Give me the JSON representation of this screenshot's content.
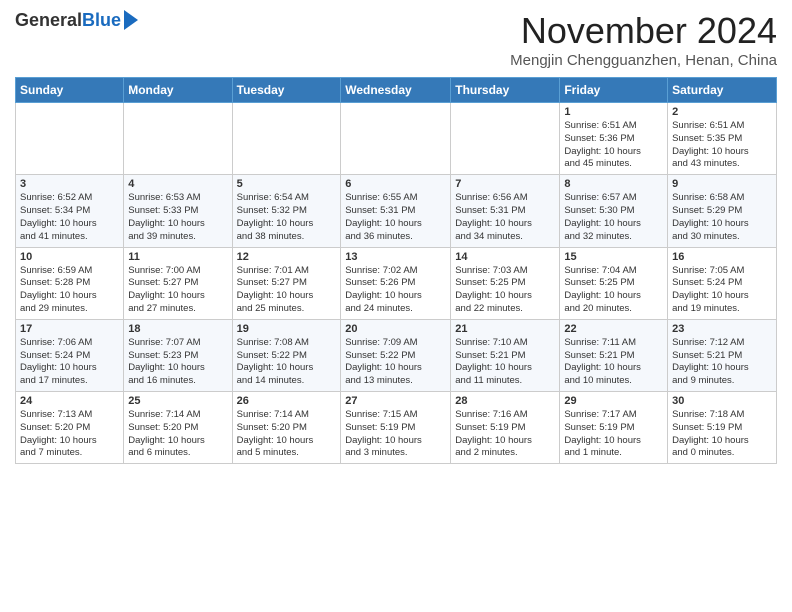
{
  "header": {
    "logo_general": "General",
    "logo_blue": "Blue",
    "month": "November 2024",
    "location": "Mengjin Chengguanzhen, Henan, China"
  },
  "days_of_week": [
    "Sunday",
    "Monday",
    "Tuesday",
    "Wednesday",
    "Thursday",
    "Friday",
    "Saturday"
  ],
  "weeks": [
    [
      {
        "day": "",
        "info": ""
      },
      {
        "day": "",
        "info": ""
      },
      {
        "day": "",
        "info": ""
      },
      {
        "day": "",
        "info": ""
      },
      {
        "day": "",
        "info": ""
      },
      {
        "day": "1",
        "info": "Sunrise: 6:51 AM\nSunset: 5:36 PM\nDaylight: 10 hours\nand 45 minutes."
      },
      {
        "day": "2",
        "info": "Sunrise: 6:51 AM\nSunset: 5:35 PM\nDaylight: 10 hours\nand 43 minutes."
      }
    ],
    [
      {
        "day": "3",
        "info": "Sunrise: 6:52 AM\nSunset: 5:34 PM\nDaylight: 10 hours\nand 41 minutes."
      },
      {
        "day": "4",
        "info": "Sunrise: 6:53 AM\nSunset: 5:33 PM\nDaylight: 10 hours\nand 39 minutes."
      },
      {
        "day": "5",
        "info": "Sunrise: 6:54 AM\nSunset: 5:32 PM\nDaylight: 10 hours\nand 38 minutes."
      },
      {
        "day": "6",
        "info": "Sunrise: 6:55 AM\nSunset: 5:31 PM\nDaylight: 10 hours\nand 36 minutes."
      },
      {
        "day": "7",
        "info": "Sunrise: 6:56 AM\nSunset: 5:31 PM\nDaylight: 10 hours\nand 34 minutes."
      },
      {
        "day": "8",
        "info": "Sunrise: 6:57 AM\nSunset: 5:30 PM\nDaylight: 10 hours\nand 32 minutes."
      },
      {
        "day": "9",
        "info": "Sunrise: 6:58 AM\nSunset: 5:29 PM\nDaylight: 10 hours\nand 30 minutes."
      }
    ],
    [
      {
        "day": "10",
        "info": "Sunrise: 6:59 AM\nSunset: 5:28 PM\nDaylight: 10 hours\nand 29 minutes."
      },
      {
        "day": "11",
        "info": "Sunrise: 7:00 AM\nSunset: 5:27 PM\nDaylight: 10 hours\nand 27 minutes."
      },
      {
        "day": "12",
        "info": "Sunrise: 7:01 AM\nSunset: 5:27 PM\nDaylight: 10 hours\nand 25 minutes."
      },
      {
        "day": "13",
        "info": "Sunrise: 7:02 AM\nSunset: 5:26 PM\nDaylight: 10 hours\nand 24 minutes."
      },
      {
        "day": "14",
        "info": "Sunrise: 7:03 AM\nSunset: 5:25 PM\nDaylight: 10 hours\nand 22 minutes."
      },
      {
        "day": "15",
        "info": "Sunrise: 7:04 AM\nSunset: 5:25 PM\nDaylight: 10 hours\nand 20 minutes."
      },
      {
        "day": "16",
        "info": "Sunrise: 7:05 AM\nSunset: 5:24 PM\nDaylight: 10 hours\nand 19 minutes."
      }
    ],
    [
      {
        "day": "17",
        "info": "Sunrise: 7:06 AM\nSunset: 5:24 PM\nDaylight: 10 hours\nand 17 minutes."
      },
      {
        "day": "18",
        "info": "Sunrise: 7:07 AM\nSunset: 5:23 PM\nDaylight: 10 hours\nand 16 minutes."
      },
      {
        "day": "19",
        "info": "Sunrise: 7:08 AM\nSunset: 5:22 PM\nDaylight: 10 hours\nand 14 minutes."
      },
      {
        "day": "20",
        "info": "Sunrise: 7:09 AM\nSunset: 5:22 PM\nDaylight: 10 hours\nand 13 minutes."
      },
      {
        "day": "21",
        "info": "Sunrise: 7:10 AM\nSunset: 5:21 PM\nDaylight: 10 hours\nand 11 minutes."
      },
      {
        "day": "22",
        "info": "Sunrise: 7:11 AM\nSunset: 5:21 PM\nDaylight: 10 hours\nand 10 minutes."
      },
      {
        "day": "23",
        "info": "Sunrise: 7:12 AM\nSunset: 5:21 PM\nDaylight: 10 hours\nand 9 minutes."
      }
    ],
    [
      {
        "day": "24",
        "info": "Sunrise: 7:13 AM\nSunset: 5:20 PM\nDaylight: 10 hours\nand 7 minutes."
      },
      {
        "day": "25",
        "info": "Sunrise: 7:14 AM\nSunset: 5:20 PM\nDaylight: 10 hours\nand 6 minutes."
      },
      {
        "day": "26",
        "info": "Sunrise: 7:14 AM\nSunset: 5:20 PM\nDaylight: 10 hours\nand 5 minutes."
      },
      {
        "day": "27",
        "info": "Sunrise: 7:15 AM\nSunset: 5:19 PM\nDaylight: 10 hours\nand 3 minutes."
      },
      {
        "day": "28",
        "info": "Sunrise: 7:16 AM\nSunset: 5:19 PM\nDaylight: 10 hours\nand 2 minutes."
      },
      {
        "day": "29",
        "info": "Sunrise: 7:17 AM\nSunset: 5:19 PM\nDaylight: 10 hours\nand 1 minute."
      },
      {
        "day": "30",
        "info": "Sunrise: 7:18 AM\nSunset: 5:19 PM\nDaylight: 10 hours\nand 0 minutes."
      }
    ]
  ]
}
